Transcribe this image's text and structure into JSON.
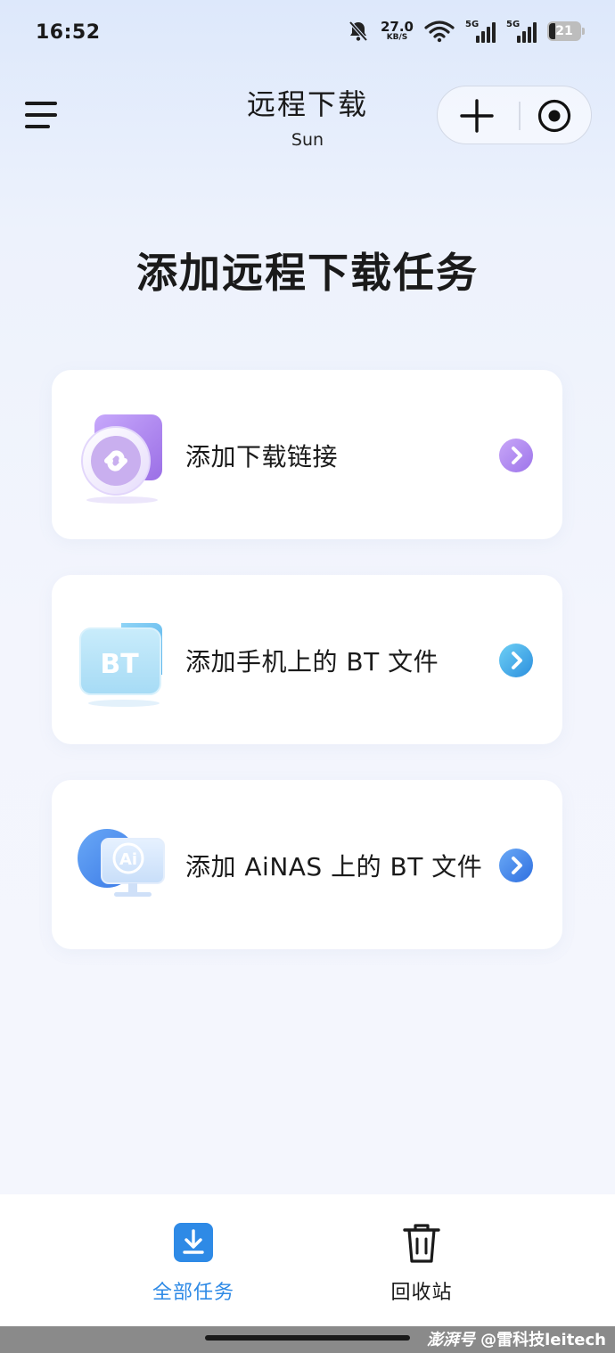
{
  "status_bar": {
    "time": "16:52",
    "net_speed": "27.0",
    "net_unit": "KB/S",
    "sim1": "5G",
    "sim2": "5G",
    "battery": "21"
  },
  "header": {
    "title": "远程下载",
    "subtitle": "Sun"
  },
  "main": {
    "heading": "添加远程下载任务",
    "options": [
      {
        "label": "添加下载链接",
        "icon": "link-icon",
        "accent": "#b08cf0"
      },
      {
        "label": "添加手机上的 BT 文件",
        "icon": "bt-folder-icon",
        "badge": "BT",
        "accent": "#3aa3e3"
      },
      {
        "label": "添加 AiNAS 上的 BT 文件",
        "icon": "ai-nas-icon",
        "badge": "Ai",
        "accent": "#3d86ec"
      }
    ]
  },
  "tabbar": {
    "tabs": [
      {
        "label": "全部任务",
        "icon": "download-icon",
        "active": true,
        "color": "#2e8ae6"
      },
      {
        "label": "回收站",
        "icon": "trash-icon",
        "active": false,
        "color": "#1a1a1a"
      }
    ]
  },
  "watermark": {
    "brand": "澎湃号",
    "handle": "@雷科技leitech"
  }
}
